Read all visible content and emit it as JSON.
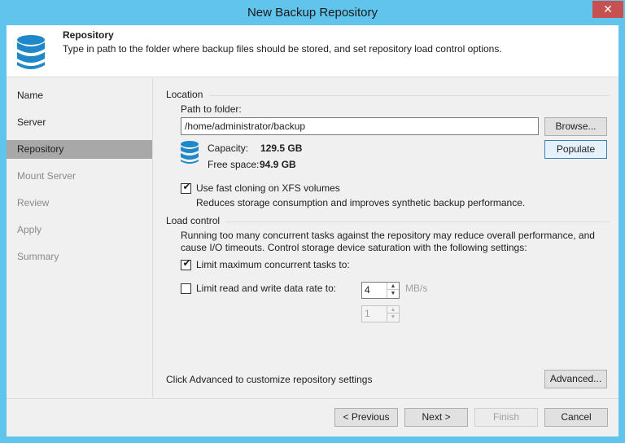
{
  "window": {
    "title": "New Backup Repository",
    "close_glyph": "✕"
  },
  "header": {
    "icon": "database-icon",
    "title": "Repository",
    "description": "Type in path to the folder where backup files should be stored, and set repository load control options."
  },
  "steps": [
    {
      "label": "Name",
      "state": "done"
    },
    {
      "label": "Server",
      "state": "done"
    },
    {
      "label": "Repository",
      "state": "active"
    },
    {
      "label": "Mount Server",
      "state": "pending"
    },
    {
      "label": "Review",
      "state": "pending"
    },
    {
      "label": "Apply",
      "state": "pending"
    },
    {
      "label": "Summary",
      "state": "pending"
    }
  ],
  "location": {
    "section_label": "Location",
    "path_label": "Path to folder:",
    "path_value": "/home/administrator/backup",
    "browse_label": "Browse...",
    "populate_label": "Populate",
    "capacity_label": "Capacity:",
    "capacity_value": "129.5 GB",
    "free_label": "Free space:",
    "free_value": "94.9 GB",
    "fast_clone": {
      "checked": true,
      "label": "Use fast cloning on XFS volumes",
      "description": "Reduces storage consumption and improves synthetic backup performance."
    }
  },
  "load_control": {
    "section_label": "Load control",
    "description_line1": "Running too many concurrent tasks against the repository may reduce overall performance, and",
    "description_line2": "cause I/O timeouts. Control storage device saturation with the following settings:",
    "limit_tasks": {
      "checked": true,
      "label": "Limit maximum concurrent tasks to:",
      "value": "4"
    },
    "limit_rate": {
      "checked": false,
      "label": "Limit read and write data rate to:",
      "value": "1",
      "unit": "MB/s"
    }
  },
  "advanced": {
    "text": "Click Advanced to customize repository settings",
    "button_label": "Advanced..."
  },
  "footer": {
    "previous_label": "< Previous",
    "next_label": "Next >",
    "finish_label": "Finish",
    "cancel_label": "Cancel"
  },
  "colors": {
    "title_bar": "#61c4ec",
    "close_button": "#c75050",
    "active_step": "#a8a8a8",
    "database_icon": "#1e88c8"
  }
}
